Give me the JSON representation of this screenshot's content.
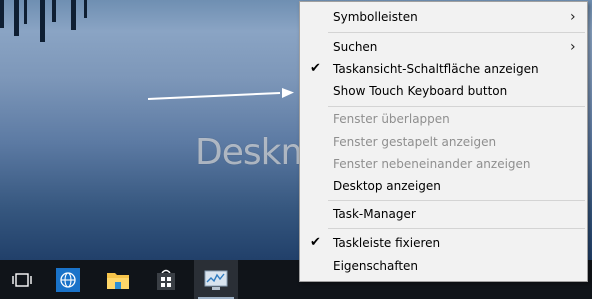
{
  "watermark": {
    "text": "Deskmodder.de"
  },
  "menu": {
    "items": [
      {
        "label": "Symbolleisten",
        "checked": false,
        "disabled": false,
        "submenu": true
      },
      {
        "label": "Suchen",
        "checked": false,
        "disabled": false,
        "submenu": true
      },
      {
        "label": "Taskansicht-Schaltfläche anzeigen",
        "checked": true,
        "disabled": false,
        "submenu": false
      },
      {
        "label": "Show Touch Keyboard button",
        "checked": false,
        "disabled": false,
        "submenu": false
      },
      {
        "label": "Fenster überlappen",
        "checked": false,
        "disabled": true,
        "submenu": false
      },
      {
        "label": "Fenster gestapelt anzeigen",
        "checked": false,
        "disabled": true,
        "submenu": false
      },
      {
        "label": "Fenster nebeneinander anzeigen",
        "checked": false,
        "disabled": true,
        "submenu": false
      },
      {
        "label": "Desktop anzeigen",
        "checked": false,
        "disabled": false,
        "submenu": false
      },
      {
        "label": "Task-Manager",
        "checked": false,
        "disabled": false,
        "submenu": false
      },
      {
        "label": "Taskleiste fixieren",
        "checked": true,
        "disabled": false,
        "submenu": false
      },
      {
        "label": "Eigenschaften",
        "checked": false,
        "disabled": false,
        "submenu": false
      }
    ],
    "check_glyph": "✔",
    "submenu_glyph": "›"
  },
  "taskbar": {
    "icons": [
      {
        "name": "task-view-icon"
      },
      {
        "name": "internet-explorer-icon"
      },
      {
        "name": "file-explorer-icon"
      },
      {
        "name": "store-icon"
      },
      {
        "name": "performance-monitor-icon",
        "active": true
      }
    ]
  },
  "colors": {
    "menu_bg": "#f2f2f2",
    "taskbar_bg": "#101419",
    "disabled_text": "#8f8f8f"
  }
}
